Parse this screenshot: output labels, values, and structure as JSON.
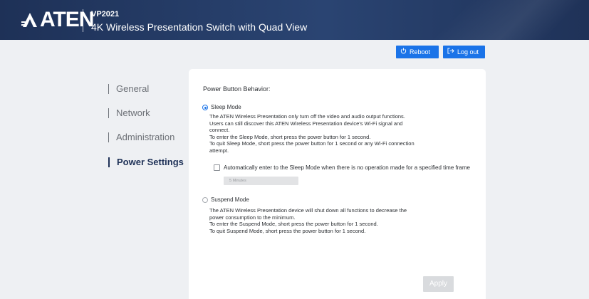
{
  "header": {
    "logo_text": "ATEN",
    "model": "VP2021",
    "product_name": "4K Wireless Presentation Switch with Quad View"
  },
  "toolbar": {
    "reboot_label": "Reboot",
    "logout_label": "Log out"
  },
  "sidebar": {
    "items": [
      {
        "label": "General",
        "active": false
      },
      {
        "label": "Network",
        "active": false
      },
      {
        "label": "Administration",
        "active": false
      },
      {
        "label": "Power Settings",
        "active": true
      }
    ]
  },
  "main": {
    "section_title": "Power Button Behavior:",
    "sleep": {
      "label": "Sleep Mode",
      "selected": true,
      "description": [
        "The ATEN Wireless Presentation only turn off the video and audio output functions.",
        "Users can still discover this ATEN Wireless Presentation device's Wi-Fi signal and",
        "connect.",
        "To enter the Sleep Mode, short press the power button for 1 second.",
        "To quit Sleep Mode, short press the power button for 1 second or any Wi-Fi connection",
        "attempt."
      ],
      "auto_checkbox_label": "Automatically enter to the Sleep Mode when there is no operation made for a specified time frame",
      "auto_checked": false,
      "timeout_value": "5 Minutes"
    },
    "suspend": {
      "label": "Suspend Mode",
      "selected": false,
      "description": [
        "The ATEN Wireless Presentation device will shut down all functions to decrease the",
        "power consumption to the minimum.",
        "To enter the Suspend Mode, short press the power button for 1 second.",
        "To quit Suspend Mode, short press the power button for 1 second."
      ]
    },
    "apply_label": "Apply"
  },
  "colors": {
    "header_bg": "#1e3157",
    "accent_blue": "#1a73e8",
    "active_nav": "#1e3157",
    "page_bg": "#eef0f3"
  }
}
